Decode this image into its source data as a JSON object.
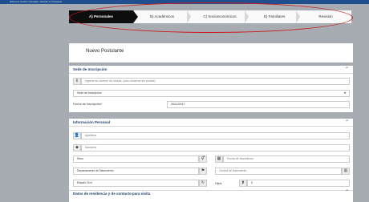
{
  "topbar": {
    "text": "Sistema de Gestión Universidad - Admisión de Postulantes"
  },
  "steps": [
    {
      "label": "A) Personales",
      "active": true
    },
    {
      "label": "B) Académicos",
      "active": false
    },
    {
      "label": "C) Socioeconómicos",
      "active": false
    },
    {
      "label": "D) Familiares",
      "active": false
    },
    {
      "label": "Revisión",
      "active": false
    }
  ],
  "header": {
    "title": "Nuevo Postulante"
  },
  "sede": {
    "title": "Sede de Inscripción",
    "search_placeholder": "Ingrese su número de cédula, (sólo números sin puntos)",
    "select_value": "Sede de Inscripción",
    "fecha_label": "Fecha de Inscripción",
    "fecha_value": "26/12/2017",
    "required_mark": "*"
  },
  "personal": {
    "title": "Información Personal",
    "apellidos_placeholder": "Apellidos",
    "nombres_placeholder": "Nombres",
    "sexo_label": "Sexo",
    "fecha_nac_placeholder": "Fecha de Nacimiento",
    "depto_label": "Departamento de Nacimiento",
    "ciudad_placeholder": "Ciudad de Nacimiento",
    "estado_label": "Estado Civil",
    "hijos_label": "Hijos",
    "hijos_value": "0"
  },
  "residencia": {
    "title": "Datos de residencia y de contacto para visita"
  }
}
